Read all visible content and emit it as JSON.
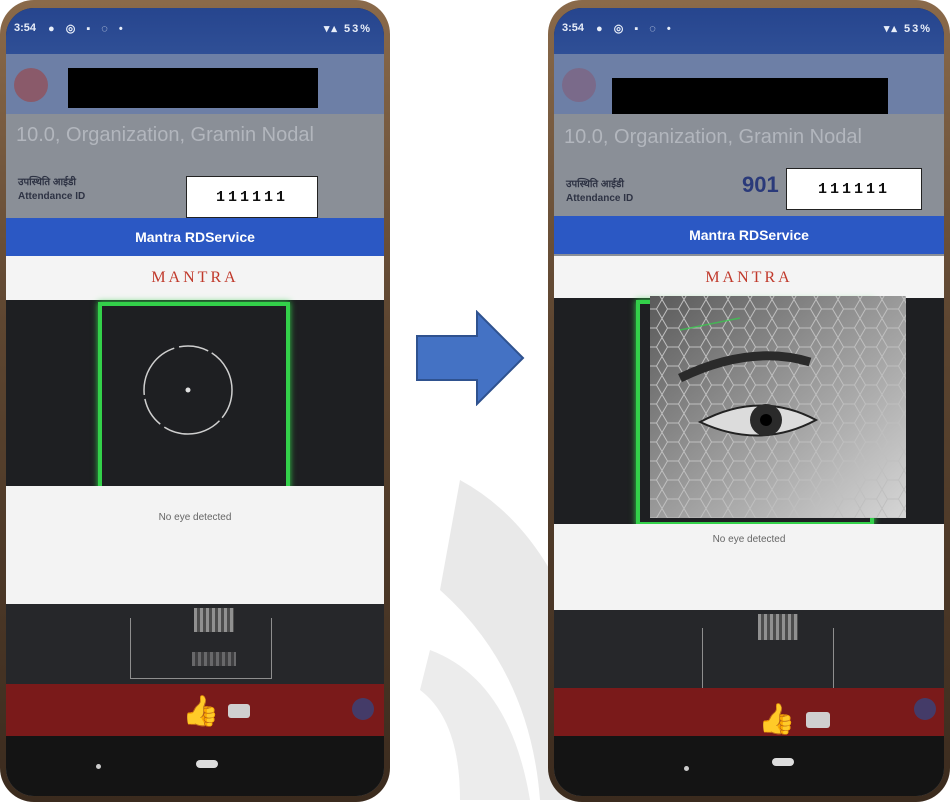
{
  "colors": {
    "status_bar": "#2f4f96",
    "dialog_title_bg": "#2b58c4",
    "frame_green": "#33d04a",
    "arrow_fill": "#4472c4",
    "arrow_stroke": "#2f528f",
    "brand_red": "#c0392b"
  },
  "before": {
    "status": {
      "time": "3:54",
      "battery": "53%"
    },
    "org_text": "10.0, Organization, Gramin Nodal",
    "attendance_label_hi": "उपस्थिति आईडी",
    "attendance_label_en": "Attendance ID",
    "attendance_id_value": "111111",
    "dialog_title": "Mantra RDService",
    "brand": "MANTRA",
    "message": "No eye detected",
    "icons": [
      "circle-target-icon",
      "thumbs-up-icon",
      "camera-icon",
      "home-icon",
      "back-icon"
    ]
  },
  "after": {
    "status": {
      "time": "3:54",
      "battery": "53%"
    },
    "org_text": "10.0, Organization, Gramin Nodal",
    "attendance_label_hi": "उपस्थिति आईडी",
    "attendance_label_en": "Attendance ID",
    "partial_id": "901",
    "attendance_id_value": "111111",
    "dialog_title": "Mantra RDService",
    "brand": "MANTRA",
    "message": "No eye detected",
    "icons": [
      "eye-scan-icon",
      "thumbs-up-icon",
      "camera-icon",
      "home-icon",
      "back-icon"
    ]
  },
  "transition_arrow": "right-arrow-icon"
}
